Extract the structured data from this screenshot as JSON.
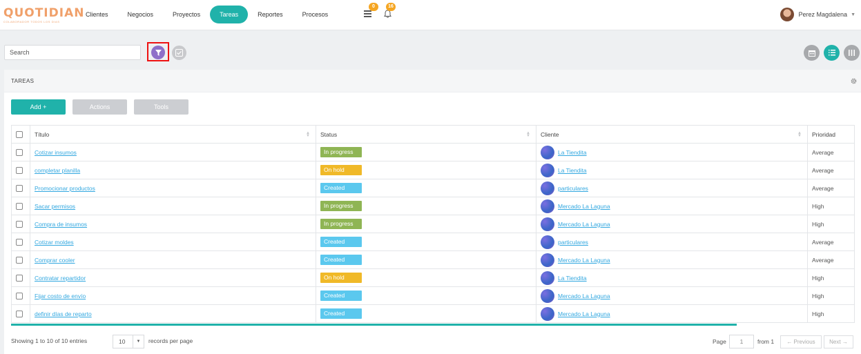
{
  "brand": {
    "name": "QUOTIDIAN",
    "tagline": "Colaborador todos los dias"
  },
  "nav": {
    "items": [
      {
        "label": "Clientes"
      },
      {
        "label": "Negocios"
      },
      {
        "label": "Proyectos"
      },
      {
        "label": "Tareas",
        "active": true
      },
      {
        "label": "Reportes"
      },
      {
        "label": "Procesos"
      }
    ],
    "tasks_badge": "0",
    "notifications_badge": "16"
  },
  "user": {
    "name": "Perez Magdalena"
  },
  "toolbar": {
    "search_placeholder": "Search"
  },
  "panel": {
    "title": "TAREAS",
    "add_label": "Add +",
    "actions_label": "Actions",
    "tools_label": "Tools"
  },
  "table": {
    "headers": {
      "title": "Título",
      "status": "Status",
      "client": "Cliente",
      "priority": "Prioridad"
    },
    "rows": [
      {
        "title": "Cotizar insumos",
        "status": "In progress",
        "client": "La Tiendita",
        "priority": "Average"
      },
      {
        "title": "completar planilla",
        "status": "On hold",
        "client": "La Tiendita",
        "priority": "Average"
      },
      {
        "title": "Promocionar productos",
        "status": "Created",
        "client": "particulares",
        "priority": "Average"
      },
      {
        "title": "Sacar permisos",
        "status": "In progress",
        "client": "Mercado La Laguna",
        "priority": "High"
      },
      {
        "title": "Compra de insumos",
        "status": "In progress",
        "client": "Mercado La Laguna",
        "priority": "High"
      },
      {
        "title": "Cotizar moldes",
        "status": "Created",
        "client": "particulares",
        "priority": "Average"
      },
      {
        "title": "Comprar cooler",
        "status": "Created",
        "client": "Mercado La Laguna",
        "priority": "Average"
      },
      {
        "title": "Contratar repartidor",
        "status": "On hold",
        "client": "La Tiendita",
        "priority": "High"
      },
      {
        "title": "Fijar costo de envío",
        "status": "Created",
        "client": "Mercado La Laguna",
        "priority": "High"
      },
      {
        "title": "definir días de reparto",
        "status": "Created",
        "client": "Mercado La Laguna",
        "priority": "High"
      }
    ]
  },
  "status_colors": {
    "In progress": "#8fb554",
    "On hold": "#f0b928",
    "Created": "#5bc8ee"
  },
  "accent_color": "#20b2aa",
  "footer": {
    "showing": "Showing 1 to 10 of 10 entries",
    "per_page_value": "10",
    "per_page_label": "records per page",
    "page_label": "Page",
    "page_value": "1",
    "from_label": "from 1",
    "prev_label": "← Previous",
    "next_label": "Next →"
  }
}
